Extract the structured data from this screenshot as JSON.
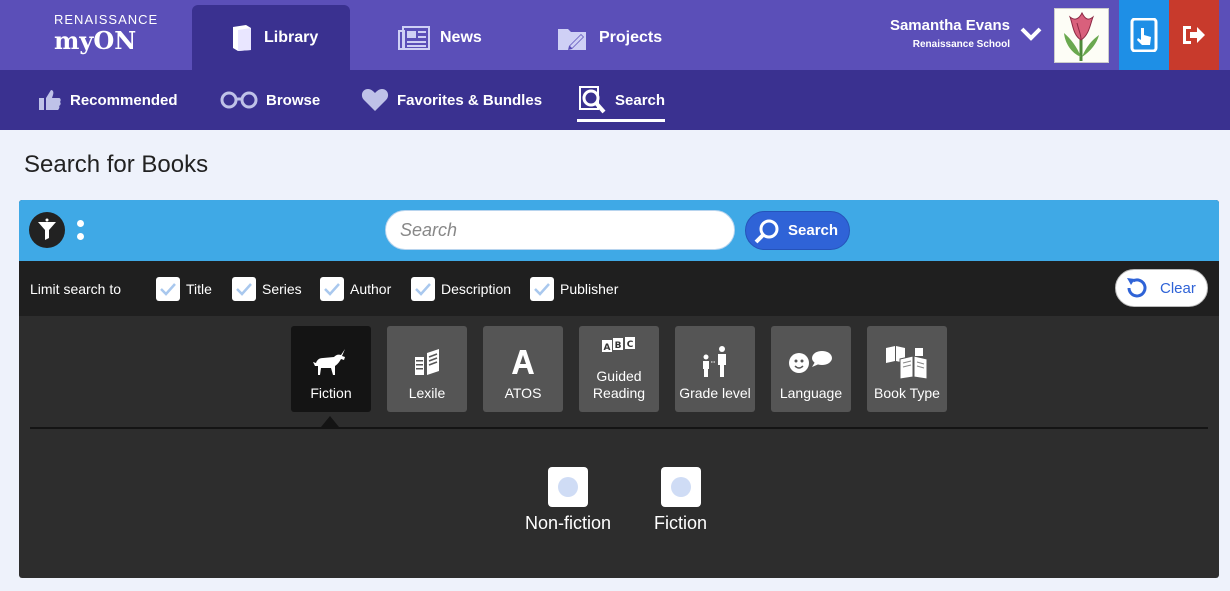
{
  "brand": {
    "line1": "RENAISSANCE",
    "line2": "myON"
  },
  "top_tabs": [
    {
      "label": "Library",
      "icon": "book-icon",
      "active": true
    },
    {
      "label": "News",
      "icon": "newspaper-icon",
      "active": false
    },
    {
      "label": "Projects",
      "icon": "folder-pencil-icon",
      "active": false
    }
  ],
  "user": {
    "name": "Samantha Evans",
    "school": "Renaissance School",
    "avatar": "tulip-avatar"
  },
  "sub_nav": [
    {
      "label": "Recommended",
      "icon": "thumbs-up-icon",
      "active": false
    },
    {
      "label": "Browse",
      "icon": "glasses-icon",
      "active": false
    },
    {
      "label": "Favorites & Bundles",
      "icon": "heart-icon",
      "active": false
    },
    {
      "label": "Search",
      "icon": "search-book-icon",
      "active": true
    }
  ],
  "page_title": "Search for Books",
  "search": {
    "placeholder": "Search",
    "value": "",
    "button_label": "Search"
  },
  "limit": {
    "label": "Limit search to",
    "options": [
      {
        "label": "Title",
        "checked": true
      },
      {
        "label": "Series",
        "checked": true
      },
      {
        "label": "Author",
        "checked": true
      },
      {
        "label": "Description",
        "checked": true
      },
      {
        "label": "Publisher",
        "checked": true
      }
    ],
    "clear_label": "Clear"
  },
  "facets": [
    {
      "label": "Fiction",
      "icon": "unicorn-icon",
      "active": true
    },
    {
      "label": "Lexile",
      "icon": "lexile-book-icon",
      "active": false
    },
    {
      "label": "ATOS",
      "icon": "letter-a-icon",
      "active": false
    },
    {
      "label": "Guided Reading",
      "icon": "abc-blocks-icon",
      "active": false
    },
    {
      "label": "Grade level",
      "icon": "people-height-icon",
      "active": false
    },
    {
      "label": "Language",
      "icon": "speech-face-icon",
      "active": false
    },
    {
      "label": "Book Type",
      "icon": "books-icon",
      "active": false
    }
  ],
  "fiction_options": [
    {
      "label": "Non-fiction",
      "selected": false
    },
    {
      "label": "Fiction",
      "selected": false
    }
  ],
  "colors": {
    "topbar": "#5b4fb8",
    "subnav": "#3a3190",
    "searchbar": "#3fa9e6",
    "search_button": "#2f63d7",
    "reader_button": "#1e8fe6",
    "logout_button": "#c83a2c"
  }
}
